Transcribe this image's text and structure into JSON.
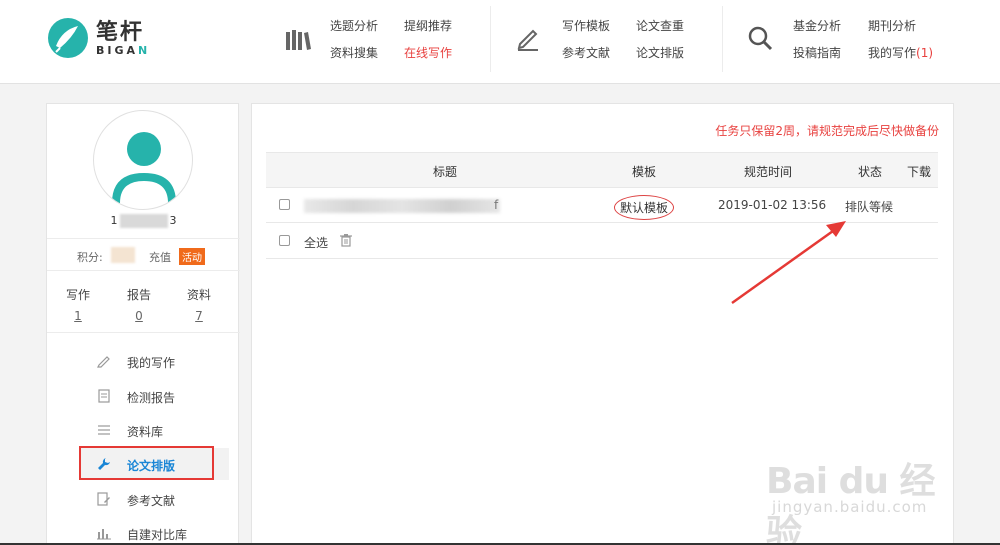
{
  "logo": {
    "cn": "笔杆",
    "en_main": "BIGA",
    "en_accent": "N"
  },
  "nav": {
    "group1": [
      "选题分析",
      "提纲推荐",
      "资料搜集",
      "在线写作"
    ],
    "group2": [
      "写作模板",
      "论文查重",
      "参考文献",
      "论文排版"
    ],
    "group3": [
      "基金分析",
      "期刊分析",
      "投稿指南",
      "我的写作"
    ],
    "my_writing_count": "(1)"
  },
  "sidebar": {
    "username_prefix": "1",
    "username_suffix": "3",
    "points_label": "积分:",
    "recharge": "充值",
    "promo_badge": "活动",
    "stats": [
      {
        "label": "写作",
        "value": "1"
      },
      {
        "label": "报告",
        "value": "0"
      },
      {
        "label": "资料",
        "value": "7"
      }
    ],
    "menu": [
      "我的写作",
      "检测报告",
      "资料库",
      "论文排版",
      "参考文献",
      "自建对比库"
    ]
  },
  "main": {
    "notice": "任务只保留2周，请规范完成后尽快做备份",
    "columns": [
      "标题",
      "模板",
      "规范时间",
      "状态",
      "下载"
    ],
    "rows": [
      {
        "title_tail": "f",
        "template": "默认模板",
        "time": "2019-01-02 13:56",
        "status": "排队等候"
      }
    ],
    "select_all": "全选"
  },
  "watermark": {
    "main": "Bai du 经验",
    "sub": "jingyan.baidu.com"
  },
  "colors": {
    "accent": "#26b3ab",
    "alert": "#e8413f",
    "link_active": "#1a86d6"
  }
}
